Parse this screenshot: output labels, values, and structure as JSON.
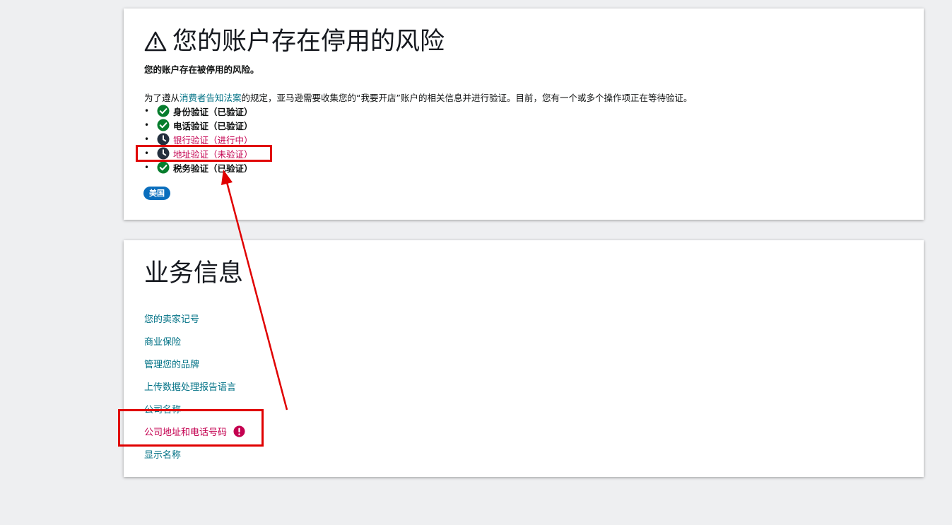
{
  "risk_card": {
    "title": "您的账户存在停用的风险",
    "subtitle": "您的账户存在被停用的风险。",
    "description_prefix": "为了遵从",
    "description_link": "消费者告知法案",
    "description_suffix": "的规定，亚马逊需要收集您的“我要开店”账户的相关信息并进行验证。目前，您有一个或多个操作项正在等待验证。",
    "verifications": [
      {
        "label": "身份验证（已验证）",
        "status": "verified",
        "icon": "check-circle-icon"
      },
      {
        "label": "电话验证（已验证）",
        "status": "verified",
        "icon": "check-circle-icon"
      },
      {
        "label": "银行验证（进行中）",
        "status": "pending",
        "icon": "clock-icon"
      },
      {
        "label": "地址验证（未验证）",
        "status": "pending",
        "icon": "clock-icon"
      },
      {
        "label": "税务验证（已验证）",
        "status": "verified",
        "icon": "check-circle-icon"
      }
    ],
    "region_badge": "美国"
  },
  "business_card": {
    "title": "业务信息",
    "links": [
      {
        "label": "您的卖家记号",
        "alert": false
      },
      {
        "label": "商业保险",
        "alert": false
      },
      {
        "label": "管理您的品牌",
        "alert": false
      },
      {
        "label": "上传数据处理报告语言",
        "alert": false
      },
      {
        "label": "公司名称",
        "alert": false
      },
      {
        "label": "公司地址和电话号码",
        "alert": true
      },
      {
        "label": "显示名称",
        "alert": false
      }
    ]
  },
  "colors": {
    "link": "#007185",
    "alert": "#c40050",
    "verified": "#067d2d",
    "pending": "#232f3e",
    "badge": "#0a6ebd",
    "annotation": "#e00000"
  }
}
